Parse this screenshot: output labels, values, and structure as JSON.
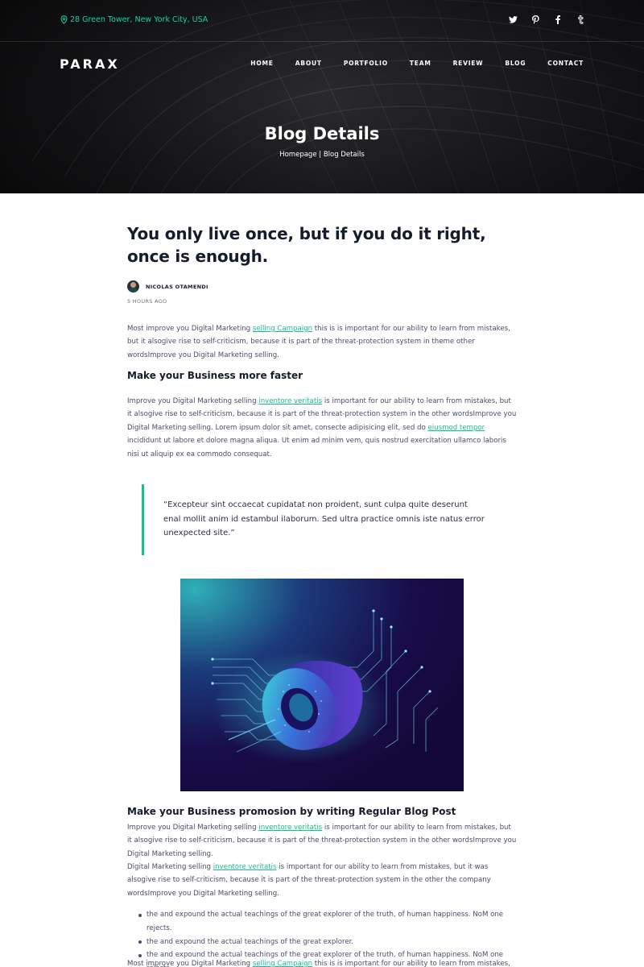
{
  "topbar": {
    "address": "28 Green Tower, New York City, USA",
    "address_icon": "map-pin-icon",
    "socials": [
      {
        "icon": "twitter-icon"
      },
      {
        "icon": "pinterest-icon"
      },
      {
        "icon": "facebook-icon"
      },
      {
        "icon": "tumblr-icon"
      }
    ]
  },
  "navbar": {
    "logo": "PARAX",
    "items": [
      "HOME",
      "ABOUT",
      "PORTFOLIO",
      "TEAM",
      "REVIEW",
      "BLOG",
      "CONTACT"
    ]
  },
  "hero": {
    "title": "Blog Details",
    "breadcrumb": "Homepage | Blog Details"
  },
  "post": {
    "title": "You only live once, but if you do it right, once is enough.",
    "author": "NICOLAS OTAMENDI",
    "time": "5 HOURS AGO",
    "p1": {
      "before": "Most improve you Digital Marketing ",
      "link": "selling Campaign",
      "after": " this is is important for our ability to learn from mistakes, but it alsogive rise to self-criticism, because it is part of the threat-protection system in theme other wordsImprove you Digital Marketing selling."
    },
    "section1_heading": "Make your Business more faster",
    "p2": {
      "part1": "Improve you Digital Marketing selling ",
      "link1": "inventore veritatis",
      "part2": " is important for our ability to learn from mistakes, but it alsogive rise to self-criticism, because it is part of the threat-protection system in the other wordsImprove you Digital Marketing selling. Lorem ipsum dolor sit amet, consecte adipisicing elit, sed do ",
      "link2": "eiusmod tempor",
      "part3": " incididunt ut labore et dolore magna aliqua. Ut enim ad minim vem, quis nostrud exercitation ullamco laboris nisi ut aliquip ex ea commodo consequat."
    },
    "quote": "“Excepteur sint occaecat cupidatat non proident, sunt culpa quite deserunt enal mollit anim id estambul ilaborum. Sed ultra practice omnis iste natus error unexpected site.”",
    "section2_heading": "Make your Business promosion by writing Regular Blog Post",
    "p3": {
      "before": "Improve you Digital Marketing selling ",
      "link": "inventore veritatis",
      "after": " is important for our ability to learn from mistakes, but it alsogive rise to self-criticism, because it is part of the threat-protection system in the other wordsImprove you Digital Marketing selling."
    },
    "p4": {
      "before": "Digital Marketing selling ",
      "link": "inventore veritatis",
      "after": " is important for our ability to learn from mistakes, but it was alsogive rise to self-criticism, because it is part of the threat-protection system in the other the company wordsImprove you Digital Marketing selling."
    },
    "bullets": [
      "the and expound the actual teachings of the great explorer of the truth, of human happiness. NoM one rejects.",
      "the and expound the actual teachings of the great explorer.",
      "the and expound the actual teachings of the great explorer of the truth, of human happiness. NoM one rejects."
    ],
    "p5": {
      "before": "Most improve you Digital Marketing ",
      "link": "selling Campaign",
      "after": " this is is important for our ability to learn from mistakes, but it"
    }
  },
  "colors": {
    "accent": "#17c18a",
    "heading": "#161c2d",
    "body_text": "#4a4e6a",
    "illustration_bg": "#1a0b45"
  }
}
